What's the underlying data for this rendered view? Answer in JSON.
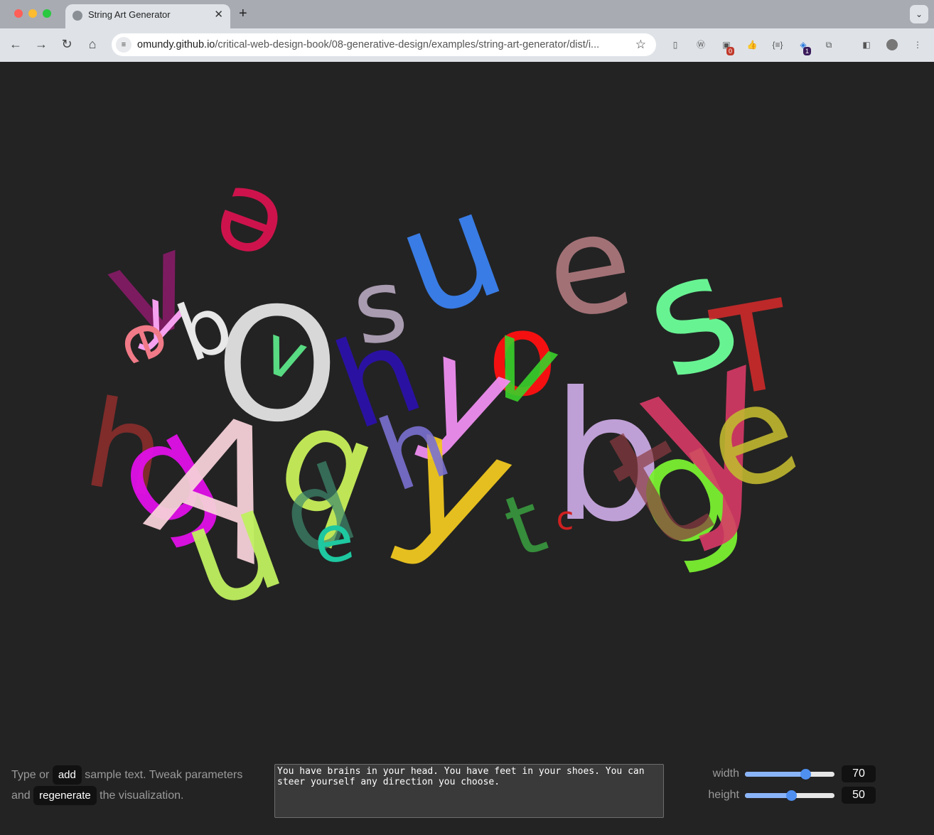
{
  "browser": {
    "tab_title": "String Art Generator",
    "tab_close_icon": "close-icon",
    "new_tab_icon": "plus-icon",
    "url_host": "omundy.github.io",
    "url_path": "/critical-web-design-book/08-generative-design/examples/string-art-generator/dist/i...",
    "badges": {
      "ext_a": "0",
      "ext_b": "1"
    }
  },
  "art": {
    "letters": [
      {
        "ch": "e",
        "fill": "#d8134f"
      },
      {
        "ch": "v",
        "fill": "#8d1a6b"
      },
      {
        "ch": "y",
        "fill": "#f6a1ef"
      },
      {
        "ch": "e",
        "fill": "#f07a87"
      },
      {
        "ch": "b",
        "fill": "#e8e8e8"
      },
      {
        "ch": "O",
        "fill": "#e8e8e8"
      },
      {
        "ch": "v",
        "fill": "#5ef08d"
      },
      {
        "ch": "h",
        "fill": "#8a2e2c"
      },
      {
        "ch": "g",
        "fill": "#e010e8"
      },
      {
        "ch": "A",
        "fill": "#f6d0d8"
      },
      {
        "ch": "b",
        "fill": "#c8f05a"
      },
      {
        "ch": "d",
        "fill": "#3d8a6d"
      },
      {
        "ch": "n",
        "fill": "#3b82f0"
      },
      {
        "ch": "s",
        "fill": "#b8a8c0"
      },
      {
        "ch": "e",
        "fill": "#b07a80"
      },
      {
        "ch": "s",
        "fill": "#6dff9a"
      },
      {
        "ch": "o",
        "fill": "#f41010"
      },
      {
        "ch": "v",
        "fill": "#3ad02a"
      },
      {
        "ch": "y",
        "fill": "#ef8ef0"
      },
      {
        "ch": "h",
        "fill": "#2c10b0"
      },
      {
        "ch": "y",
        "fill": "#f0c820"
      },
      {
        "ch": "h",
        "fill": "#7a70d0"
      },
      {
        "ch": "b",
        "fill": "#c8a8e0"
      },
      {
        "ch": "g",
        "fill": "#7af032"
      },
      {
        "ch": "y",
        "fill": "#d83a66"
      },
      {
        "ch": "T",
        "fill": "#d82a2a"
      },
      {
        "ch": "e",
        "fill": "#c0b830"
      },
      {
        "ch": "t",
        "fill": "#8a3a40"
      },
      {
        "ch": "e",
        "fill": "#1ec8a0"
      },
      {
        "ch": "t",
        "fill": "#3aa040"
      },
      {
        "ch": "u",
        "fill": "#c0f060"
      },
      {
        "ch": "c",
        "fill": "#d02020"
      }
    ]
  },
  "controls": {
    "instr_before": "Type or",
    "add_label": "add",
    "instr_middle": "sample text. Tweak parameters",
    "instr_and": "and",
    "regenerate_label": "regenerate",
    "instr_after": "the visualization.",
    "sample_text": "You have brains in your head. You have feet in your shoes. You can steer yourself any direction you choose.",
    "width_label": "width",
    "width_value": "70",
    "height_label": "height",
    "height_value": "50"
  }
}
